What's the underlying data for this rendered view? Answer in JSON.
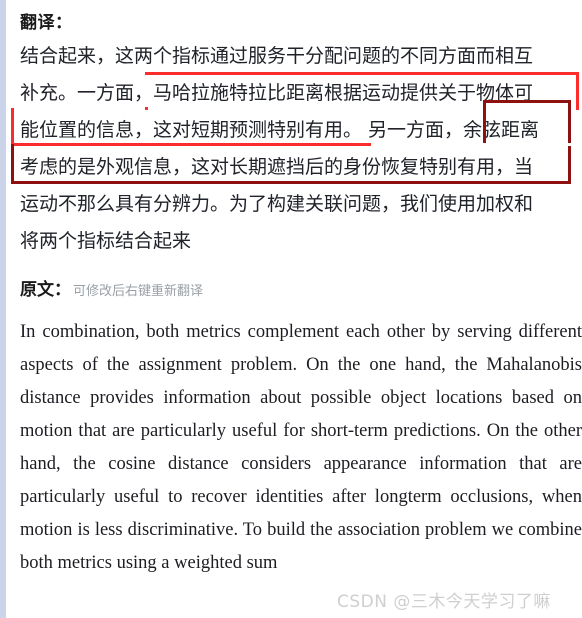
{
  "translation": {
    "heading": "翻译：",
    "lines": [
      "结合起来，这两个指标通过服务干分配问题的不同方面而相互",
      "补充。一方面，马哈拉施特拉比距离根据运动提供关于物体可",
      "能位置的信息，这对短期预测特别有用。 另一方面，余弦距离",
      "考虑的是外观信息，这对长期遮挡后的身份恢复特别有用，当",
      "运动不那么具有分辨力。为了构建关联问题，我们使用加权和",
      "将两个指标结合起来"
    ],
    "full_text": "结合起来，这两个指标通过服务干分配问题的不同方面而相互补充。一方面，马哈拉施特拉比距离根据运动提供关于物体可能位置的信息，这对短期预测特别有用。 另一方面，余弦距离考虑的是外观信息，这对长期遮挡后的身份恢复特别有用，当运动不那么具有分辨力。为了构建关联问题，我们使用加权和将两个指标结合起来"
  },
  "annotations": [
    {
      "id": "annotation-box-1",
      "style": "bright-red",
      "color": "#fb2c2c",
      "phrase": "马哈拉施特拉比距离根据运动提供关于物体可能位置的信息，这对短期预测特别有用。"
    },
    {
      "id": "annotation-box-2",
      "style": "dark-red",
      "color": "#8d1111",
      "phrase": "余弦距离考虑的是外观信息，这对长期遮挡后的身份恢复特别有用，当"
    }
  ],
  "original": {
    "label": "原文：",
    "hint": "可修改后右键重新翻译",
    "text": "In combination, both metrics complement each other by serving different aspects of the assignment problem. On the one hand, the Mahalanobis distance provides information about possible object locations based on motion that are particularly useful for short-term predictions. On the other hand, the cosine distance considers appearance information that are particularly useful to recover identities after longterm occlusions, when motion is less discriminative. To build the association problem we combine both metrics using a weighted sum"
  },
  "watermark": {
    "text": "CSDN @三木今天学习了嘛",
    "color": "#cfcfcf"
  }
}
